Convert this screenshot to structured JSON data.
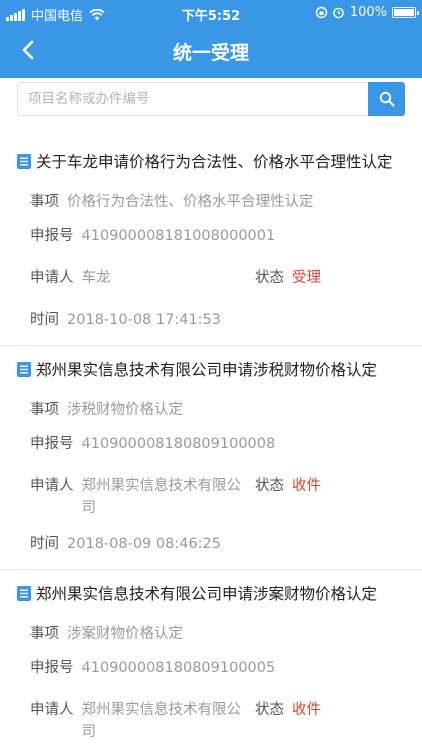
{
  "status_bar": {
    "carrier": "中国电信",
    "time": "下午5:52",
    "battery": "100%"
  },
  "header": {
    "title": "统一受理"
  },
  "search": {
    "placeholder": "项目名称或办件编号"
  },
  "labels": {
    "item": "事项",
    "number": "申报号",
    "applicant": "申请人",
    "state": "状态",
    "time": "时间"
  },
  "records": [
    {
      "title": "关于车龙申请价格行为合法性、价格水平合理性认定",
      "item": "价格行为合法性、价格水平合理性认定",
      "number": "410900008181008000001",
      "applicant": "车龙",
      "state": "受理",
      "time": "2018-10-08 17:41:53"
    },
    {
      "title": "郑州果实信息技术有限公司申请涉税财物价格认定",
      "item": "涉税财物价格认定",
      "number": "410900008180809100008",
      "applicant": "郑州果实信息技术有限公司",
      "state": "收件",
      "time": "2018-08-09 08:46:25"
    },
    {
      "title": "郑州果实信息技术有限公司申请涉案财物价格认定",
      "item": "涉案财物价格认定",
      "number": "410900008180809100005",
      "applicant": "郑州果实信息技术有限公司",
      "state": "收件",
      "time": ""
    }
  ],
  "colors": {
    "primary": "#3a97e6",
    "state": "#d0453a"
  }
}
